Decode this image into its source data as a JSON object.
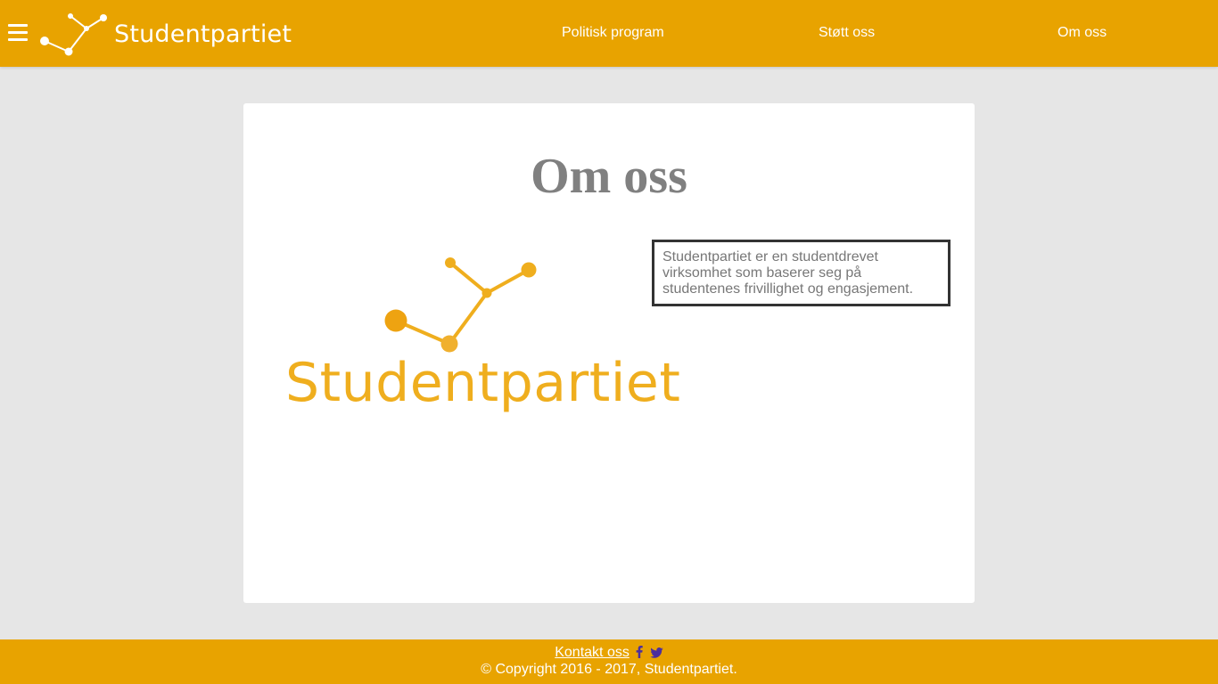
{
  "header": {
    "brand": "Studentpartiet",
    "nav": [
      {
        "label": "Politisk program"
      },
      {
        "label": "Støtt oss"
      },
      {
        "label": "Om oss"
      }
    ]
  },
  "main": {
    "title": "Om oss",
    "logo_text": "Studentpartiet",
    "about_text": "Studentpartiet er en studentdrevet virksomhet som baserer seg på studentenes frivillighet og engasjement."
  },
  "footer": {
    "contact_label": "Kontakt oss",
    "social_icons": [
      "facebook-icon",
      "twitter-icon"
    ],
    "copyright": "© Copyright 2016 - 2017, Studentpartiet."
  },
  "colors": {
    "header_bg": "#e8a300",
    "page_bg": "#e6e6e6",
    "logo_orange": "#efae1e",
    "social_icon": "#4b2e9e"
  }
}
